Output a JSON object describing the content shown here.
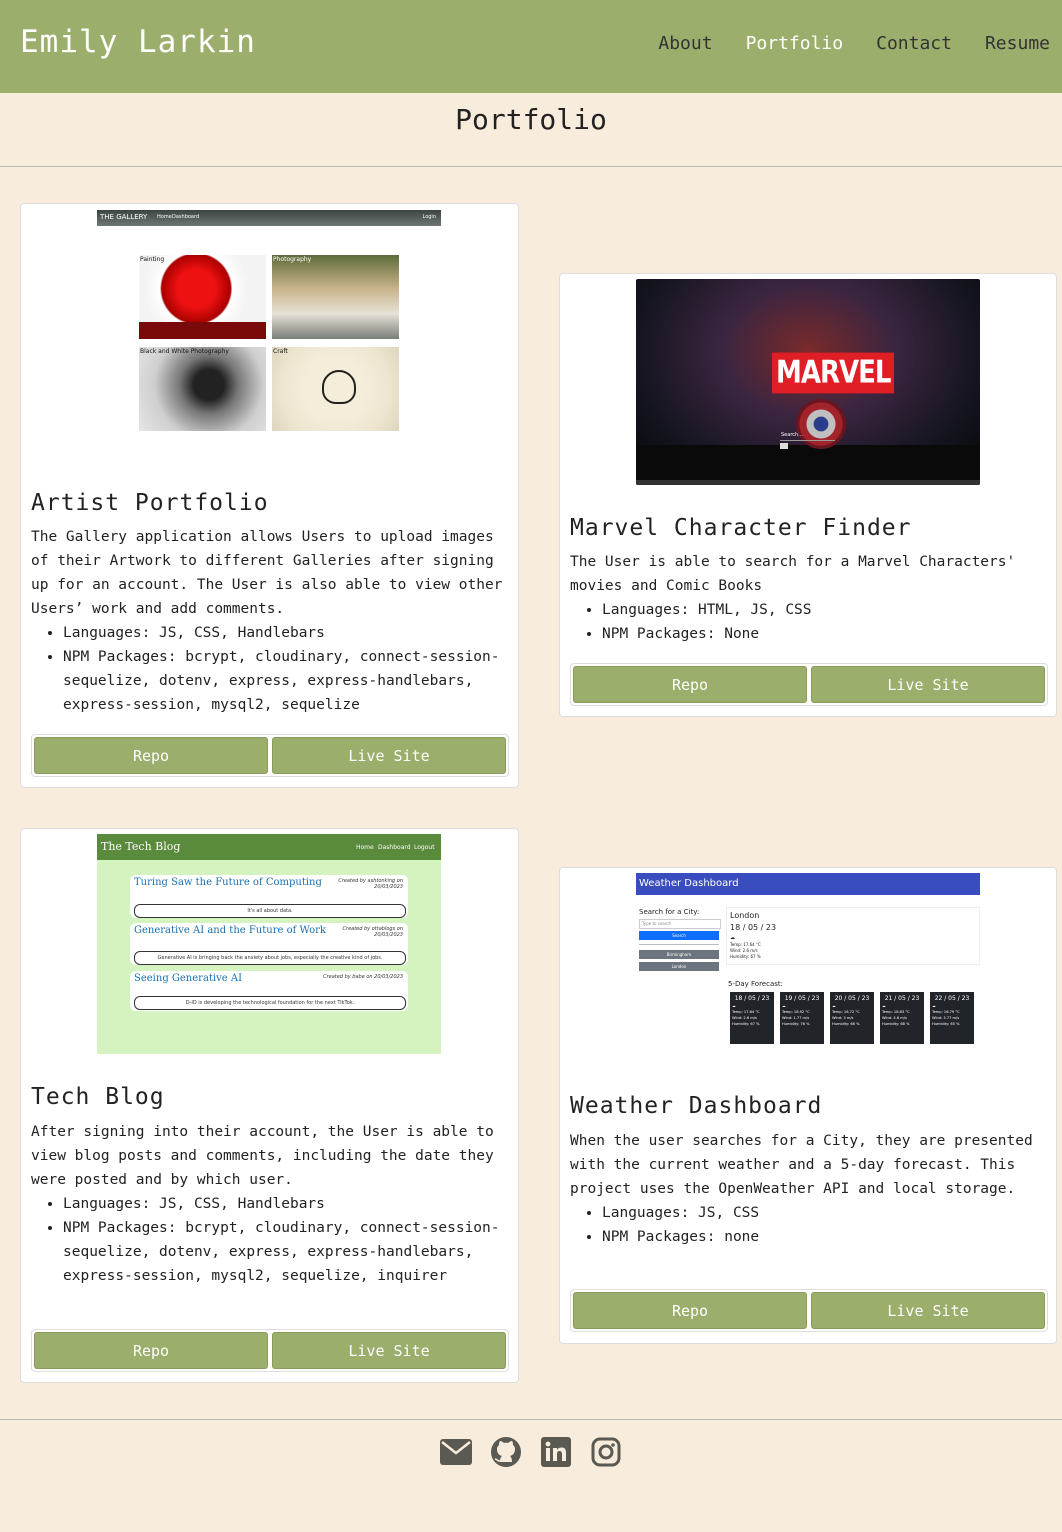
{
  "header": {
    "brand": "Emily Larkin",
    "nav": [
      "About",
      "Portfolio",
      "Contact",
      "Resume"
    ]
  },
  "page_title": "Portfolio",
  "projects": [
    {
      "title": "Artist Portfolio",
      "description": "The Gallery application allows Users to upload images of their Artwork to different Galleries after signing up for an account. The User is also able to view other Users’ work and add comments.",
      "languages": "Languages: JS, CSS, Handlebars",
      "packages": "NPM Packages: bcrypt, cloudinary, connect-session-sequelize, dotenv, express, express-handlebars, express-session, mysql2, sequelize",
      "repo_label": "Repo",
      "live_label": "Live Site",
      "screenshot": {
        "site_title": "THE GALLERY",
        "nav": [
          "Home",
          "Dashboard"
        ],
        "login": "Login",
        "tiles": [
          "Painting",
          "Photography",
          "Black and White Photography",
          "Craft"
        ]
      }
    },
    {
      "title": "Marvel Character Finder",
      "description": "The User is able to search for a Marvel Characters' movies and Comic Books",
      "languages": "Languages: HTML, JS, CSS",
      "packages": "NPM Packages: None",
      "repo_label": "Repo",
      "live_label": "Live Site",
      "screenshot": {
        "logo": "MARVEL",
        "search": "Search..."
      }
    },
    {
      "title": "Tech Blog",
      "description": "After signing into their account, the User is able to view blog posts and comments, including the date they were posted and by which user.",
      "languages": "Languages: JS, CSS, Handlebars",
      "packages": "NPM Packages: bcrypt, cloudinary, connect-session-sequelize, dotenv, express, express-handlebars, express-session, mysql2, sequelize, inquirer",
      "repo_label": "Repo",
      "live_label": "Live Site",
      "screenshot": {
        "site_title": "The Tech Blog",
        "nav": [
          "Home",
          "Dashboard",
          "Logout"
        ],
        "posts": [
          {
            "title": "Turing Saw the Future of Computing",
            "meta": "Created by ashtonking on 20/03/2023",
            "body": "It's all about data."
          },
          {
            "title": "Generative AI and the Future of Work",
            "meta": "Created by ottablogs on 20/03/2023",
            "body": "Generative AI is bringing back the anxiety about jobs, especially the creative kind of jobs."
          },
          {
            "title": "Seeing Generative AI",
            "meta": "Created by babe on 20/03/2023",
            "body": "D-ID is developing the technological foundation for the next TikTok."
          }
        ]
      }
    },
    {
      "title": "Weather Dashboard",
      "description": "When the user searches for a City, they are presented with the current weather and a 5-day forecast. This project uses the OpenWeather API and local storage.",
      "languages": "Languages: JS, CSS",
      "packages": "NPM Packages: none",
      "repo_label": "Repo",
      "live_label": "Live Site",
      "screenshot": {
        "site_title": "Weather Dashboard",
        "search_label": "Search for a City:",
        "search_placeholder": "Type to search",
        "search_button": "Search",
        "history": [
          "Birmingham",
          "London"
        ],
        "city": "London",
        "date": "18 / 05 / 23",
        "stats": [
          "Temp: 17.64 °C",
          "Wind: 2.6 m/s",
          "Humidity: 67 %"
        ],
        "forecast_label": "5-Day Forecast:",
        "forecast": [
          {
            "date": "18 / 05 / 23",
            "temp": "Temp: 17.64 °C",
            "wind": "Wind: 2.6 m/s",
            "hum": "Humidity: 67 %"
          },
          {
            "date": "19 / 05 / 23",
            "temp": "Temp: 18.92 °C",
            "wind": "Wind: 1.77 m/s",
            "hum": "Humidity: 76 %"
          },
          {
            "date": "20 / 05 / 23",
            "temp": "Temp: 16.72 °C",
            "wind": "Wind: 3 m/s",
            "hum": "Humidity: 66 %"
          },
          {
            "date": "21 / 05 / 23",
            "temp": "Temp: 18.83 °C",
            "wind": "Wind: 4.6 m/s",
            "hum": "Humidity: 68 %"
          },
          {
            "date": "22 / 05 / 23",
            "temp": "Temp: 16.79 °C",
            "wind": "Wind: 3.77 m/s",
            "hum": "Humidity: 65 %"
          }
        ]
      }
    }
  ],
  "footer": {
    "icons": [
      "envelope-icon",
      "github-icon",
      "linkedin-icon",
      "instagram-icon"
    ]
  },
  "colors": {
    "header_bg": "#9cae6b",
    "page_bg": "#f8ecdc",
    "button_bg": "#9cae6b"
  }
}
